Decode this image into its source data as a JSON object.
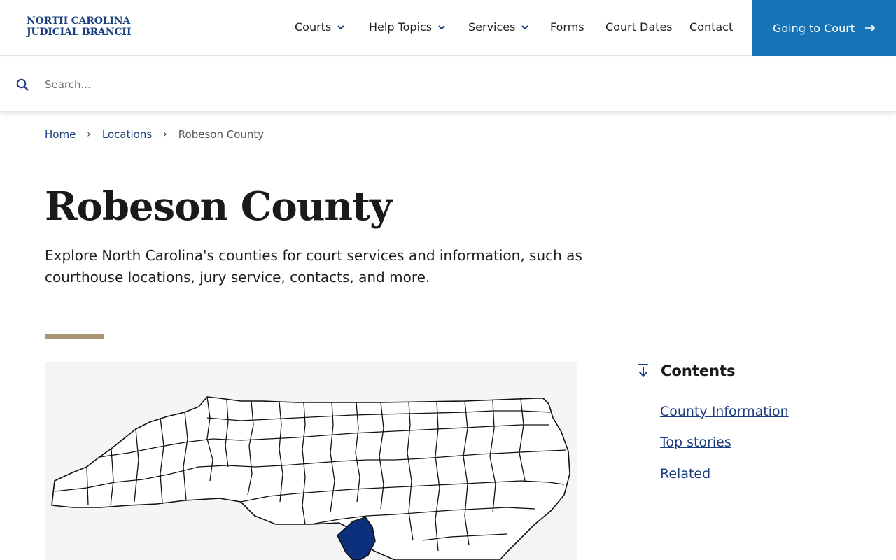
{
  "header": {
    "logo_line1": "NORTH CAROLINA",
    "logo_line2": "JUDICIAL BRANCH",
    "nav": [
      {
        "label": "Courts"
      },
      {
        "label": "Help Topics"
      },
      {
        "label": "Services"
      },
      {
        "label": "Forms"
      },
      {
        "label": "Court Dates"
      },
      {
        "label": "Contact"
      }
    ],
    "cta_label": "Going to Court",
    "cta_icon": "arrow-right-icon",
    "colors": {
      "brand": "#1a3e7e",
      "cta_bg": "#1673b5"
    }
  },
  "search": {
    "placeholder": "Search...",
    "value": "",
    "icon": "search-icon"
  },
  "breadcrumb": {
    "home": "Home",
    "locations": "Locations",
    "current": "Robeson County"
  },
  "main": {
    "title": "Robeson County",
    "intro": "Explore North Carolina's counties for court services and information, such as courthouse locations, jury service, contacts, and more.",
    "accent_color": "#a89572",
    "map_highlight_color": "#0b2f7a"
  },
  "contents": {
    "title": "Contents",
    "icon": "arrow-down-to-line-icon",
    "links": [
      {
        "label": "County Information"
      },
      {
        "label": "Top stories"
      },
      {
        "label": "Related"
      }
    ]
  }
}
